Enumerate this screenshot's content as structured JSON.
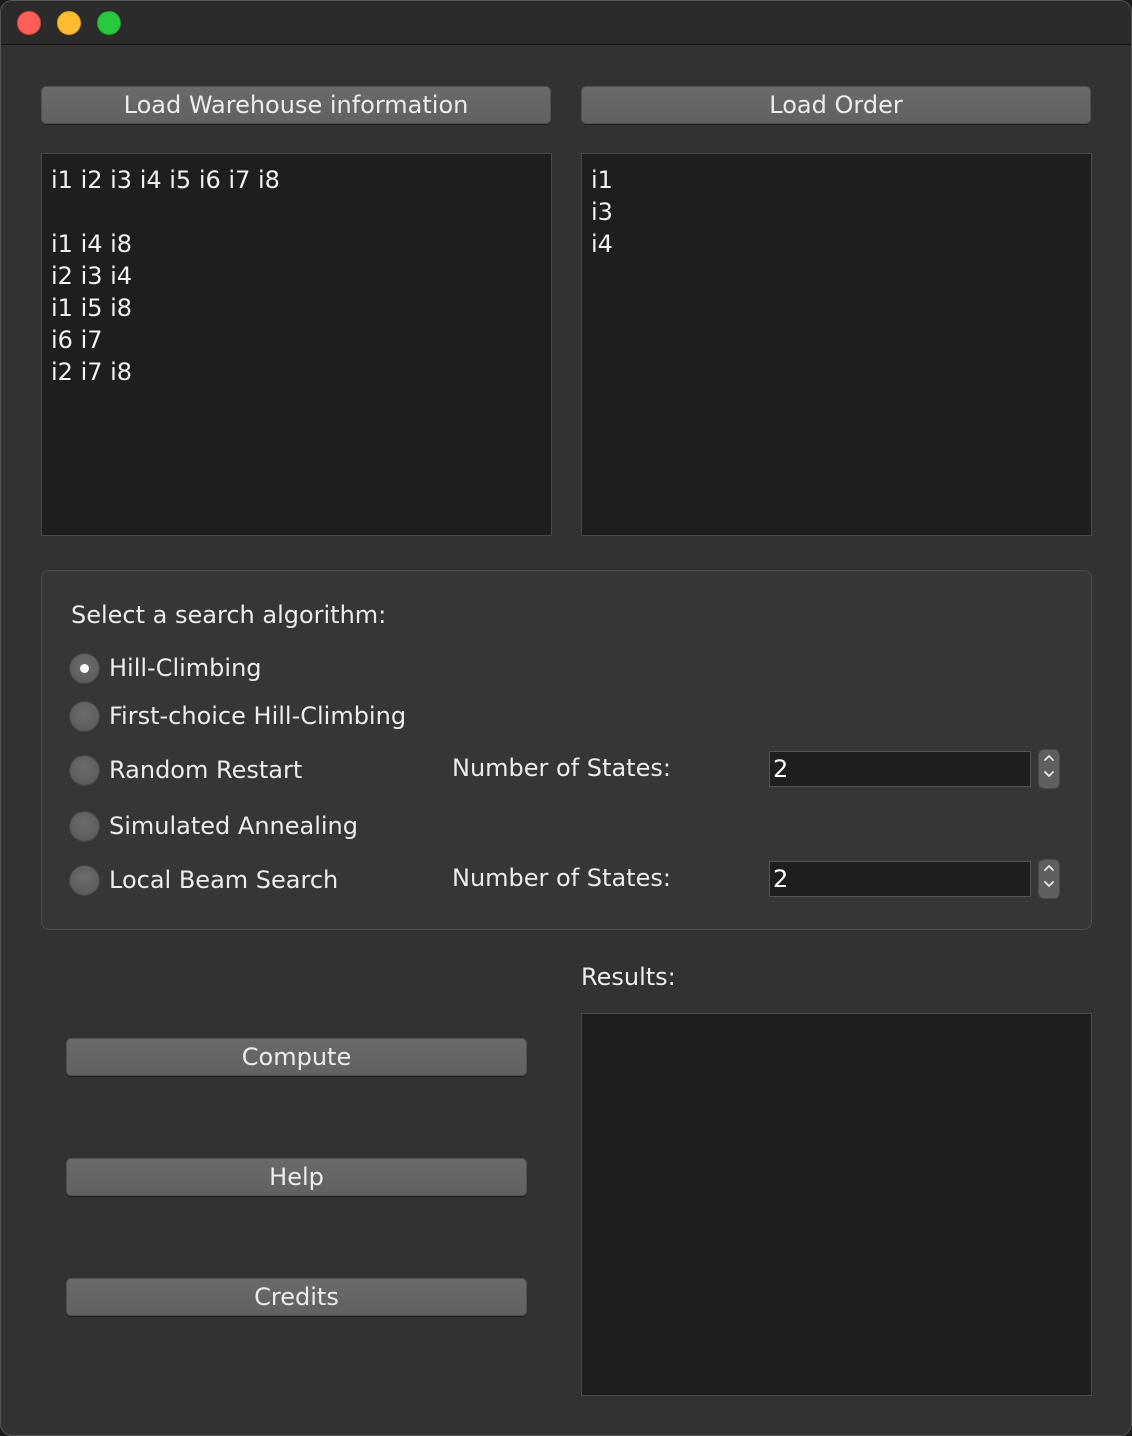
{
  "window": {
    "controls": [
      "close",
      "minimize",
      "zoom"
    ]
  },
  "buttons": {
    "load_warehouse": "Load Warehouse information",
    "load_order": "Load Order",
    "compute": "Compute",
    "help": "Help",
    "credits": "Credits"
  },
  "warehouse_text": "i1 i2 i3 i4 i5 i6 i7 i8\n\ni1 i4 i8\ni2 i3 i4\ni1 i5 i8\ni6 i7\ni2 i7 i8",
  "order_text": "i1\ni3\ni4",
  "algorithm": {
    "prompt": "Select a search algorithm:",
    "options": [
      {
        "label": "Hill-Climbing",
        "checked": true
      },
      {
        "label": "First-choice Hill-Climbing",
        "checked": false
      },
      {
        "label": "Random Restart",
        "checked": false
      },
      {
        "label": "Simulated Annealing",
        "checked": false
      },
      {
        "label": "Local Beam Search",
        "checked": false
      }
    ],
    "random_restart_states_label": "Number of States:",
    "random_restart_states_value": "2",
    "beam_states_label": "Number of States:",
    "beam_states_value": "2"
  },
  "results": {
    "label": "Results:",
    "text": ""
  }
}
